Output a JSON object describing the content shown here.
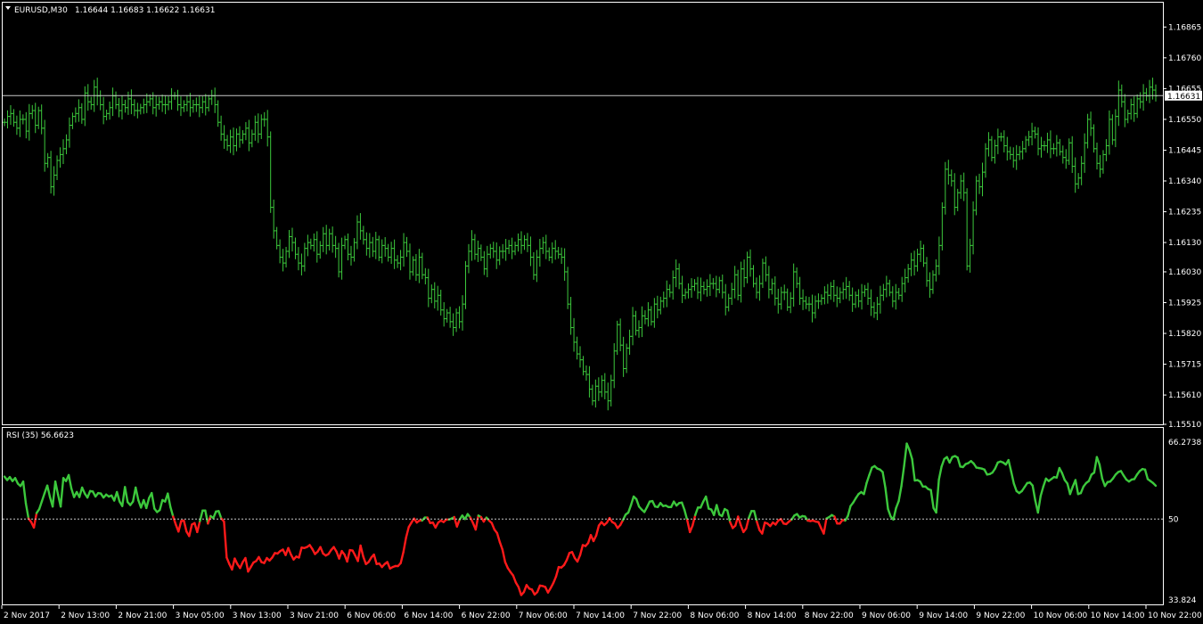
{
  "header": {
    "symbol_timeframe": "EURUSD,M30",
    "ohlc": "1.16644 1.16683 1.16622 1.16631",
    "current_price_label": "1.16631"
  },
  "rsi_header": "RSI (35) 56.6623",
  "colors": {
    "background": "#000000",
    "bar_color": "#3cc83c",
    "rsi_up": "#3cc83c",
    "rsi_down": "#ff1a1a",
    "grid_border": "#ffffff",
    "price_line": "#c8c8c8",
    "level_line": "#c8c8c8",
    "current_price_box": "#ffffff"
  },
  "chart_data": [
    {
      "type": "ohlc",
      "title": "EURUSD,M30",
      "series_values": [
        1.1654,
        1.1656,
        1.1657,
        1.1654,
        1.1652,
        1.1655,
        1.1655,
        1.1651,
        1.1657,
        1.1658,
        1.1653,
        1.1658,
        1.1652,
        1.164,
        1.1642,
        1.1632,
        1.1636,
        1.1641,
        1.1643,
        1.1645,
        1.1648,
        1.1653,
        1.1656,
        1.1657,
        1.1659,
        1.1655,
        1.1664,
        1.1661,
        1.166,
        1.1666,
        1.1663,
        1.166,
        1.1656,
        1.1657,
        1.1659,
        1.1663,
        1.166,
        1.1658,
        1.166,
        1.1659,
        1.1662,
        1.166,
        1.1658,
        1.1658,
        1.1659,
        1.166,
        1.1661,
        1.1662,
        1.1659,
        1.166,
        1.1661,
        1.166,
        1.166,
        1.1661,
        1.1663,
        1.1663,
        1.166,
        1.1659,
        1.166,
        1.1661,
        1.1659,
        1.166,
        1.166,
        1.1659,
        1.1661,
        1.1659,
        1.1662,
        1.1663,
        1.166,
        1.1654,
        1.165,
        1.1648,
        1.1646,
        1.1649,
        1.1646,
        1.165,
        1.1648,
        1.165,
        1.1652,
        1.1647,
        1.165,
        1.1654,
        1.165,
        1.1655,
        1.1655,
        1.1649,
        1.1625,
        1.1617,
        1.1612,
        1.1608,
        1.1606,
        1.161,
        1.1615,
        1.1613,
        1.1609,
        1.1606,
        1.1605,
        1.1611,
        1.1613,
        1.1612,
        1.1614,
        1.1609,
        1.1612,
        1.1616,
        1.1612,
        1.1616,
        1.1612,
        1.1611,
        1.1603,
        1.1612,
        1.1614,
        1.1609,
        1.1608,
        1.1613,
        1.162,
        1.1617,
        1.1614,
        1.1611,
        1.1613,
        1.161,
        1.1614,
        1.1608,
        1.1612,
        1.1611,
        1.1608,
        1.1611,
        1.1607,
        1.1606,
        1.1608,
        1.1613,
        1.161,
        1.1603,
        1.1607,
        1.1602,
        1.1608,
        1.1602,
        1.1601,
        1.1594,
        1.1597,
        1.1593,
        1.1595,
        1.159,
        1.1587,
        1.1589,
        1.1586,
        1.1584,
        1.1589,
        1.1586,
        1.1592,
        1.1605,
        1.161,
        1.1614,
        1.1609,
        1.1611,
        1.1608,
        1.1604,
        1.1609,
        1.1611,
        1.161,
        1.1607,
        1.161,
        1.161,
        1.1611,
        1.1612,
        1.161,
        1.1612,
        1.1614,
        1.1612,
        1.1614,
        1.1612,
        1.1608,
        1.1602,
        1.1608,
        1.1611,
        1.1613,
        1.161,
        1.1608,
        1.1611,
        1.161,
        1.1609,
        1.1608,
        1.1603,
        1.1592,
        1.1584,
        1.1579,
        1.1575,
        1.1573,
        1.1569,
        1.1568,
        1.1563,
        1.1559,
        1.1564,
        1.1562,
        1.1566,
        1.1562,
        1.1559,
        1.1566,
        1.1576,
        1.1585,
        1.1578,
        1.157,
        1.1577,
        1.1581,
        1.1588,
        1.1583,
        1.1584,
        1.1588,
        1.1587,
        1.159,
        1.1586,
        1.1592,
        1.159,
        1.1593,
        1.1594,
        1.1597,
        1.1596,
        1.1601,
        1.1604,
        1.1599,
        1.1595,
        1.1596,
        1.1597,
        1.1598,
        1.1599,
        1.1596,
        1.1598,
        1.1597,
        1.1598,
        1.1599,
        1.1599,
        1.1597,
        1.16,
        1.1596,
        1.1591,
        1.1594,
        1.1597,
        1.1602,
        1.1595,
        1.1604,
        1.1601,
        1.1608,
        1.1604,
        1.1599,
        1.1596,
        1.1599,
        1.1606,
        1.1602,
        1.1597,
        1.1599,
        1.1594,
        1.1592,
        1.1596,
        1.1596,
        1.1591,
        1.1594,
        1.1603,
        1.1599,
        1.1594,
        1.1593,
        1.1592,
        1.1592,
        1.1589,
        1.1593,
        1.1593,
        1.1594,
        1.1596,
        1.1595,
        1.1598,
        1.1595,
        1.1594,
        1.1596,
        1.1597,
        1.1598,
        1.1595,
        1.1592,
        1.1595,
        1.1593,
        1.1596,
        1.1597,
        1.1594,
        1.1591,
        1.1589,
        1.1592,
        1.1595,
        1.1597,
        1.1599,
        1.1596,
        1.1593,
        1.1596,
        1.1595,
        1.1599,
        1.1601,
        1.1604,
        1.1607,
        1.1605,
        1.1609,
        1.1611,
        1.1606,
        1.16,
        1.1597,
        1.1602,
        1.1605,
        1.1612,
        1.1625,
        1.1638,
        1.1636,
        1.1634,
        1.1625,
        1.163,
        1.1634,
        1.163,
        1.1605,
        1.1612,
        1.1624,
        1.1634,
        1.1632,
        1.1637,
        1.1645,
        1.1648,
        1.1642,
        1.1646,
        1.1649,
        1.1649,
        1.1646,
        1.1644,
        1.1643,
        1.1641,
        1.1643,
        1.1644,
        1.1645,
        1.1648,
        1.1649,
        1.1651,
        1.165,
        1.1645,
        1.1646,
        1.1646,
        1.1648,
        1.1645,
        1.1645,
        1.1647,
        1.1644,
        1.1642,
        1.1641,
        1.1647,
        1.1639,
        1.1633,
        1.1635,
        1.164,
        1.1647,
        1.1655,
        1.1652,
        1.1645,
        1.164,
        1.1638,
        1.1643,
        1.1646,
        1.1655,
        1.1648,
        1.1656,
        1.1665,
        1.1661,
        1.1655,
        1.1657,
        1.166,
        1.1657,
        1.1662,
        1.1661,
        1.1664,
        1.1663,
        1.1666,
        1.1665,
        1.1663
      ],
      "y_ticks": [
        "1.16865",
        "1.16760",
        "1.16655",
        "1.16550",
        "1.16445",
        "1.16340",
        "1.16235",
        "1.16130",
        "1.16030",
        "1.15925",
        "1.15820",
        "1.15715",
        "1.15610",
        "1.15510"
      ],
      "ylim": [
        1.1551,
        1.16945
      ],
      "current_price": 1.16631
    },
    {
      "type": "line",
      "title": "RSI (35) 56.6623",
      "level": 50,
      "y_ticks": [
        "66.2738",
        "50",
        "33.824"
      ],
      "ylim": [
        33.824,
        66.2738
      ],
      "series_values": [
        58.5,
        57.8,
        58.4,
        57.6,
        58.2,
        57.1,
        56.6,
        57.5,
        53.1,
        50.1,
        49.4,
        48.3,
        51.2,
        52.0,
        53.6,
        55.2,
        56.7,
        54.4,
        52.5,
        57.5,
        54.9,
        52.5,
        58.2,
        57.6,
        58.8,
        56.1,
        54.4,
        55.4,
        54.4,
        56.3,
        55.1,
        54.3,
        55.6,
        55.5,
        54.5,
        55.2,
        55.1,
        54.3,
        54.9,
        54.5,
        54.7,
        53.7,
        55.4,
        53.5,
        52.6,
        56.4,
        53.4,
        52.8,
        53.5,
        56.3,
        53.8,
        52.3,
        53.8,
        52.2,
        54.2,
        55.2,
        52.1,
        51.4,
        51.8,
        53.8,
        53.5,
        55.1,
        52.4,
        50.5,
        48.9,
        47.5,
        49.6,
        49.7,
        47.5,
        46.6,
        48.9,
        49.2,
        47.4,
        49.6,
        51.7,
        51.7,
        49.1,
        50.6,
        50.2,
        51.5,
        51.6,
        50.1,
        49.5,
        42.3,
        41.0,
        39.9,
        42.1,
        41.0,
        40.2,
        41.4,
        42.2,
        39.5,
        40.4,
        41.3,
        41.6,
        42.4,
        41.4,
        41.2,
        42.2,
        41.7,
        42.3,
        43.2,
        43.1,
        43.6,
        43.9,
        42.8,
        44.2,
        42.9,
        41.9,
        42.5,
        42.3,
        44.3,
        44.2,
        44.4,
        44.8,
        44.0,
        43.0,
        43.5,
        44.4,
        43.1,
        42.7,
        43.0,
        43.8,
        44.4,
        43.5,
        42.1,
        43.6,
        42.9,
        41.5,
        43.8,
        43.7,
        42.7,
        41.6,
        44.7,
        42.5,
        41.0,
        41.4,
        42.3,
        42.9,
        41.0,
        41.1,
        40.4,
        41.0,
        41.4,
        40.1,
        40.4,
        40.6,
        40.6,
        41.2,
        43.4,
        46.3,
        48.4,
        49.3,
        50.1,
        49.3,
        49.7,
        49.7,
        50.3,
        50.3,
        49.2,
        49.3,
        48.3,
        49.3,
        49.7,
        49.4,
        49.9,
        49.9,
        50.1,
        50.4,
        48.5,
        49.9,
        50.7,
        50.0,
        51.0,
        50.3,
        49.2,
        47.9,
        50.7,
        50.4,
        49.5,
        50.3,
        49.7,
        49.2,
        47.9,
        47.2,
        45.4,
        43.9,
        41.4,
        40.2,
        39.4,
        38.7,
        37.3,
        36.4,
        34.8,
        35.4,
        36.8,
        36.1,
        35.9,
        34.9,
        35.4,
        36.7,
        36.6,
        36.4,
        35.3,
        36.2,
        37.2,
        38.5,
        40.4,
        40.3,
        40.8,
        41.8,
        43.2,
        43.4,
        42.2,
        41.5,
        42.8,
        44.8,
        44.6,
        45.2,
        46.8,
        45.6,
        46.7,
        48.7,
        49.4,
        48.8,
        49.3,
        50.2,
        49.4,
        49.1,
        48.2,
        48.8,
        49.8,
        50.9,
        51.3,
        52.8,
        54.5,
        54.0,
        52.5,
        51.9,
        51.4,
        52.4,
        53.5,
        53.6,
        52.5,
        52.4,
        53.2,
        52.6,
        52.7,
        52.4,
        52.4,
        53.5,
        52.7,
        53.2,
        53.3,
        51.8,
        49.8,
        47.4,
        48.7,
        50.8,
        52.3,
        52.3,
        53.5,
        54.5,
        52.1,
        51.9,
        50.8,
        52.8,
        50.9,
        50.6,
        52.0,
        51.7,
        49.4,
        48.2,
        48.7,
        50.5,
        48.8,
        47.4,
        48.1,
        50.2,
        51.6,
        51.6,
        49.5,
        47.8,
        47.1,
        49.3,
        49.1,
        48.6,
        49.3,
        48.9,
        49.7,
        50.0,
        49.1,
        49.0,
        49.5,
        49.9,
        50.7,
        51.0,
        50.3,
        50.6,
        50.5,
        49.7,
        49.6,
        49.7,
        49.5,
        49.4,
        48.2,
        47.1,
        50.1,
        50.4,
        50.8,
        50.5,
        49.1,
        49.1,
        49.8,
        49.7,
        50.6,
        52.6,
        53.3,
        54.2,
        55.0,
        55.4,
        55.0,
        57.2,
        58.8,
        60.3,
        60.6,
        60.1,
        59.9,
        59.4,
        56.3,
        52.0,
        50.5,
        49.9,
        52.2,
        53.6,
        56.6,
        60.6,
        65.1,
        63.8,
        62.0,
        57.7,
        57.8,
        57.5,
        56.5,
        56.5,
        56.0,
        55.8,
        52.2,
        51.3,
        57.9,
        60.5,
        62.0,
        62.4,
        61.3,
        62.4,
        62.6,
        62.3,
        60.5,
        60.4,
        61.0,
        61.2,
        61.6,
        61.1,
        60.3,
        60.2,
        60.1,
        59.9,
        58.9,
        59.0,
        59.3,
        60.1,
        61.3,
        61.5,
        61.3,
        60.9,
        61.8,
        59.5,
        57.1,
        55.6,
        55.2,
        55.6,
        56.4,
        57.2,
        57.3,
        56.7,
        53.7,
        51.3,
        54.6,
        56.5,
        58.1,
        57.6,
        58.0,
        58.4,
        58.3,
        60.2,
        59.2,
        57.8,
        57.1,
        55.0,
        56.5,
        57.8,
        55.0,
        55.2,
        56.5,
        57.2,
        57.6,
        58.9,
        59.3,
        62.4,
        60.9,
        58.1,
        56.6,
        57.4,
        57.5,
        58.1,
        58.9,
        59.4,
        59.6,
        58.7,
        57.9,
        57.5,
        57.9,
        58.0,
        58.9,
        59.6,
        60.0,
        59.9,
        58.0,
        57.6,
        57.2,
        56.6623
      ]
    }
  ],
  "x_axis": {
    "tick_labels": [
      "2 Nov 2017",
      "2 Nov 13:00",
      "2 Nov 21:00",
      "3 Nov 05:00",
      "3 Nov 13:00",
      "3 Nov 21:00",
      "6 Nov 06:00",
      "6 Nov 14:00",
      "6 Nov 22:00",
      "7 Nov 06:00",
      "7 Nov 14:00",
      "7 Nov 22:00",
      "8 Nov 06:00",
      "8 Nov 14:00",
      "8 Nov 22:00",
      "9 Nov 06:00",
      "9 Nov 14:00",
      "9 Nov 22:00",
      "10 Nov 06:00",
      "10 Nov 14:00",
      "10 Nov 22:00"
    ]
  }
}
